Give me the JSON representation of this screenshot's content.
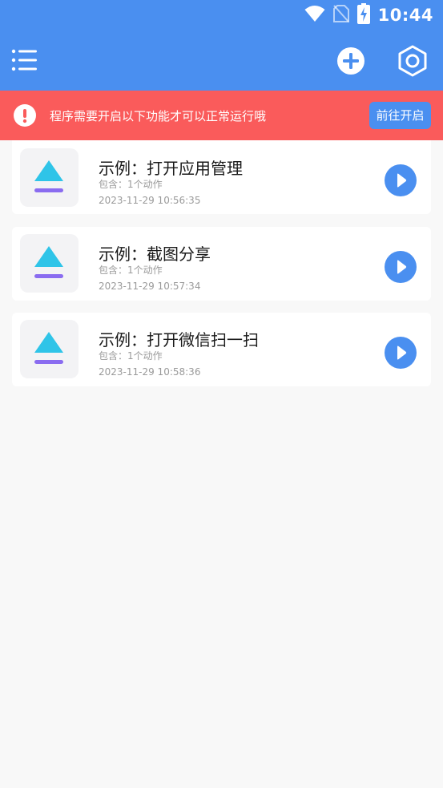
{
  "status_bar": {
    "time": "10:44",
    "icons": [
      "wifi-icon",
      "no-sim-icon",
      "battery-charging-icon"
    ]
  },
  "toolbar": {
    "menu_icon": "menu-list-icon",
    "add_icon": "add-circle-icon",
    "settings_icon": "settings-hexagon-icon"
  },
  "banner": {
    "icon": "alert-circle-icon",
    "text": "程序需要开启以下功能才可以正常运行哦",
    "button_label": "前往开启"
  },
  "items": [
    {
      "title": "示例：打开应用管理",
      "subtitle": "包含：1个动作",
      "time": "2023-11-29 10:56:35",
      "icon": "app-logo-icon"
    },
    {
      "title": "示例：截图分享",
      "subtitle": "包含：1个动作",
      "time": "2023-11-29 10:57:34",
      "icon": "app-logo-icon"
    },
    {
      "title": "示例：打开微信扫一扫",
      "subtitle": "包含：1个动作",
      "time": "2023-11-29 10:58:36",
      "icon": "app-logo-icon"
    }
  ],
  "colors": {
    "primary": "#4a8ff0",
    "banner": "#fa5b5b",
    "background": "#f8f8f8",
    "logo_cyan": "#2fc4e8",
    "logo_purple": "#8a6cf0"
  }
}
